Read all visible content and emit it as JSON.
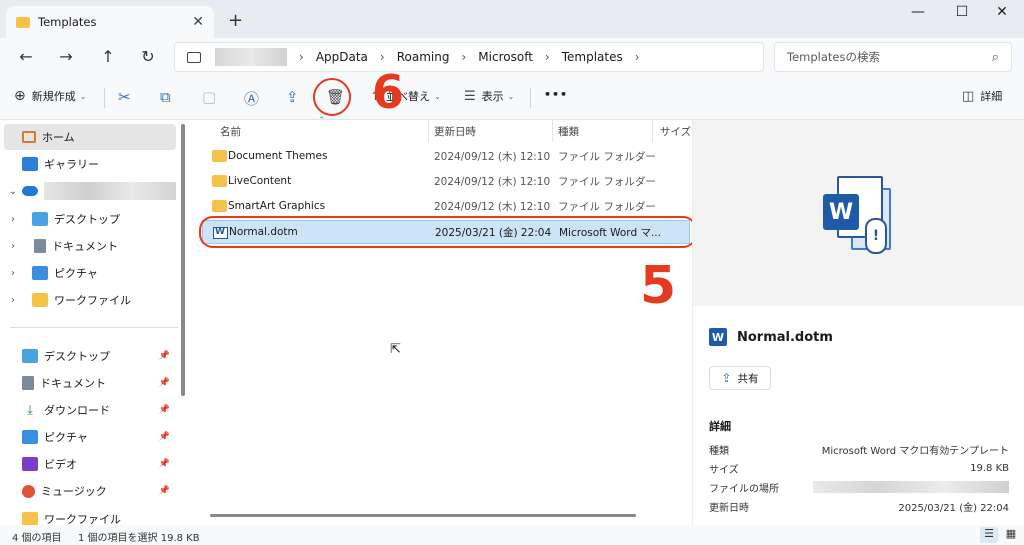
{
  "window": {
    "tab_title": "Templates",
    "new_tab": "+",
    "minimize": "—",
    "maximize": "☐",
    "close": "✕"
  },
  "nav": {
    "back": "←",
    "forward": "→",
    "up": "↑",
    "refresh": "↻",
    "breadcrumb": [
      "AppData",
      "Roaming",
      "Microsoft",
      "Templates"
    ],
    "search_placeholder": "Templatesの検索"
  },
  "toolbar": {
    "new_label": "新規作成",
    "sort_label": "並べ替え",
    "view_label": "表示",
    "more_label": "•••",
    "details_label": "詳細"
  },
  "annotations": {
    "step_delete": "6",
    "step_select": "5"
  },
  "sidebar": {
    "home": "ホーム",
    "gallery": "ギャラリー",
    "onedrive_children": [
      "デスクトップ",
      "ドキュメント",
      "ピクチャ",
      "ワークファイル"
    ],
    "quick_access": [
      "デスクトップ",
      "ドキュメント",
      "ダウンロード",
      "ピクチャ",
      "ビデオ",
      "ミュージック",
      "ワークファイル"
    ]
  },
  "file_list": {
    "columns": [
      "名前",
      "更新日時",
      "種類",
      "サイズ"
    ],
    "rows": [
      {
        "name": "Document Themes",
        "date": "2024/09/12 (木) 12:10",
        "type": "ファイル フォルダー"
      },
      {
        "name": "LiveContent",
        "date": "2024/09/12 (木) 12:10",
        "type": "ファイル フォルダー"
      },
      {
        "name": "SmartArt Graphics",
        "date": "2024/09/12 (木) 12:10",
        "type": "ファイル フォルダー"
      },
      {
        "name": "Normal.dotm",
        "date": "2025/03/21 (金) 22:04",
        "type": "Microsoft Word マ..."
      }
    ]
  },
  "details": {
    "file_name": "Normal.dotm",
    "share_label": "共有",
    "section_title": "詳細",
    "rows": [
      {
        "label": "種類",
        "value": "Microsoft Word マクロ有効テンプレート"
      },
      {
        "label": "サイズ",
        "value": "19.8 KB"
      },
      {
        "label": "ファイルの場所",
        "value": ""
      },
      {
        "label": "更新日時",
        "value": "2025/03/21 (金) 22:04"
      }
    ]
  },
  "status": {
    "count": "4 個の項目",
    "selection": "1 個の項目を選択  19.8 KB"
  },
  "colors": {
    "accent_red": "#e53a1e",
    "selection": "#cce4f7",
    "word_blue": "#1e5aa8",
    "folder": "#f5c24c"
  }
}
